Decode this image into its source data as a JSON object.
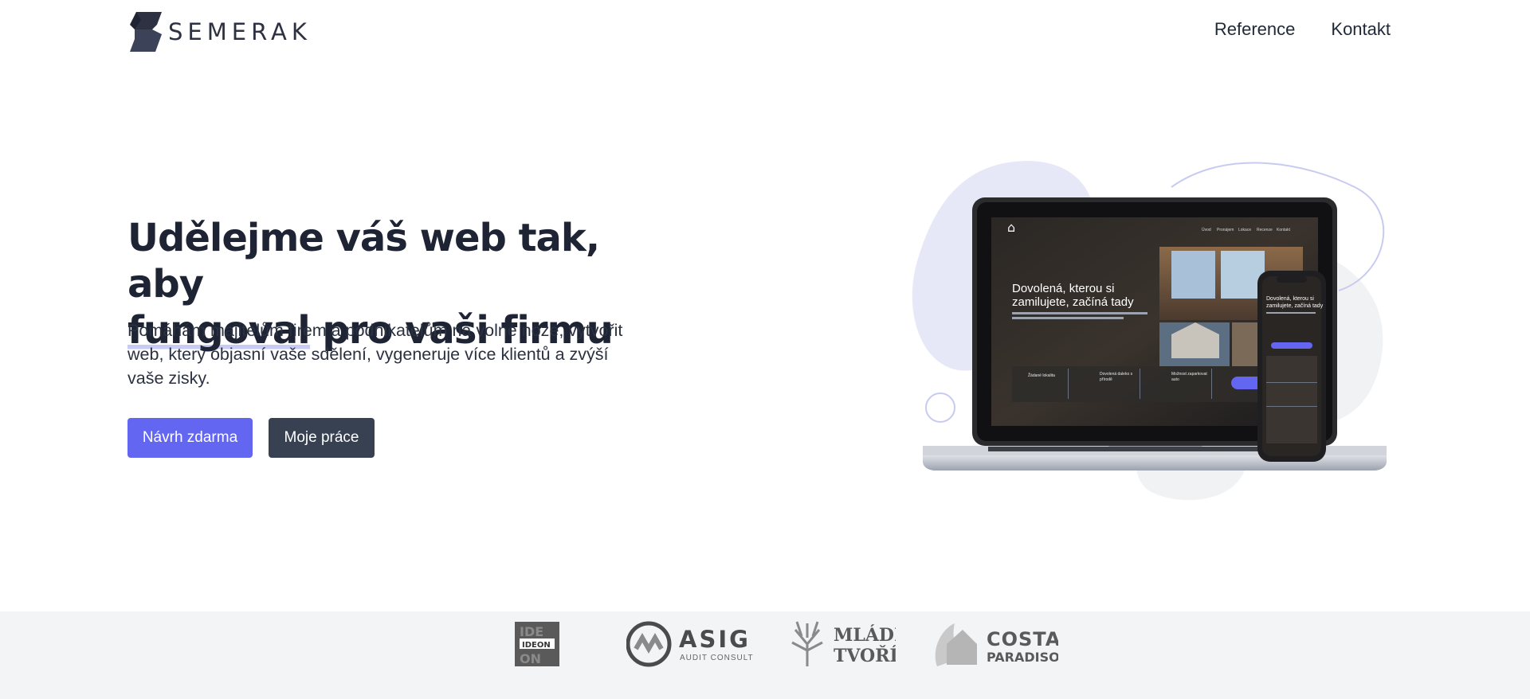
{
  "header": {
    "brand": "SEMERAK",
    "nav": [
      {
        "label": "Reference"
      },
      {
        "label": "Kontakt"
      }
    ]
  },
  "hero": {
    "title_part1": "Udělejme váš web tak, aby",
    "title_highlight": "fungoval",
    "title_part2": " pro vaši firmu",
    "subtitle": "Pomáhám majitelům firem a podnikatelům na volné noze, vytvořit web, který objasní vaše sdělení, vygeneruje více klientů a zvýší vaše zisky.",
    "primary_button": "Návrh zdarma",
    "secondary_button": "Moje práce"
  },
  "mockup": {
    "laptop_nav": [
      "Úvod",
      "Pronájem",
      "Lokace",
      "Recenze",
      "Kontakt"
    ],
    "laptop_headline_1": "Dovolená, kterou si",
    "laptop_headline_2": "zamilujete, začíná tady",
    "phone_headline_1": "Dovolená, kterou si",
    "phone_headline_2": "zamilujete, začíná tady",
    "features": [
      "Žádané lokalita",
      "Dovolená daleko s přírodě",
      "Možnost zaparkovat auto"
    ]
  },
  "clients": [
    {
      "name": "IDEON",
      "icon": "ideon-logo"
    },
    {
      "name": "ASIG",
      "sub": "AUDIT  CONSULT",
      "icon": "asig-logo"
    },
    {
      "name": "MLÁDÍ",
      "name2": "TVOŘÍ",
      "icon": "mladi-tvori-logo"
    },
    {
      "name": "COSTA",
      "name2": "PARADISO",
      "icon": "costa-paradiso-logo"
    }
  ],
  "colors": {
    "accent": "#6366f1",
    "dark_button": "#374151",
    "heading": "#1e2433",
    "strip_bg": "#f3f4f6"
  }
}
